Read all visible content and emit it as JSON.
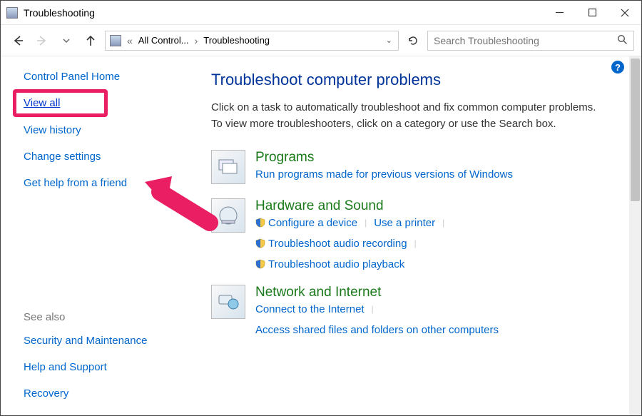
{
  "window": {
    "title": "Troubleshooting"
  },
  "breadcrumb": {
    "seg1": "All Control...",
    "seg2": "Troubleshooting"
  },
  "search": {
    "placeholder": "Search Troubleshooting"
  },
  "sidebar": {
    "home": "Control Panel Home",
    "view_all": "View all",
    "view_history": "View history",
    "change_settings": "Change settings",
    "get_help": "Get help from a friend",
    "see_also": "See also",
    "security": "Security and Maintenance",
    "help_support": "Help and Support",
    "recovery": "Recovery"
  },
  "main": {
    "heading": "Troubleshoot computer problems",
    "description": "Click on a task to automatically troubleshoot and fix common computer problems. To view more troubleshooters, click on a category or use the Search box."
  },
  "categories": [
    {
      "title": "Programs",
      "links": [
        {
          "text": "Run programs made for previous versions of Windows",
          "shield": false
        }
      ]
    },
    {
      "title": "Hardware and Sound",
      "links": [
        {
          "text": "Configure a device",
          "shield": true
        },
        {
          "text": "Use a printer",
          "shield": false
        },
        {
          "text": "Troubleshoot audio recording",
          "shield": true
        },
        {
          "text": "Troubleshoot audio playback",
          "shield": true
        }
      ]
    },
    {
      "title": "Network and Internet",
      "links": [
        {
          "text": "Connect to the Internet",
          "shield": false
        },
        {
          "text": "Access shared files and folders on other computers",
          "shield": false
        }
      ]
    }
  ]
}
